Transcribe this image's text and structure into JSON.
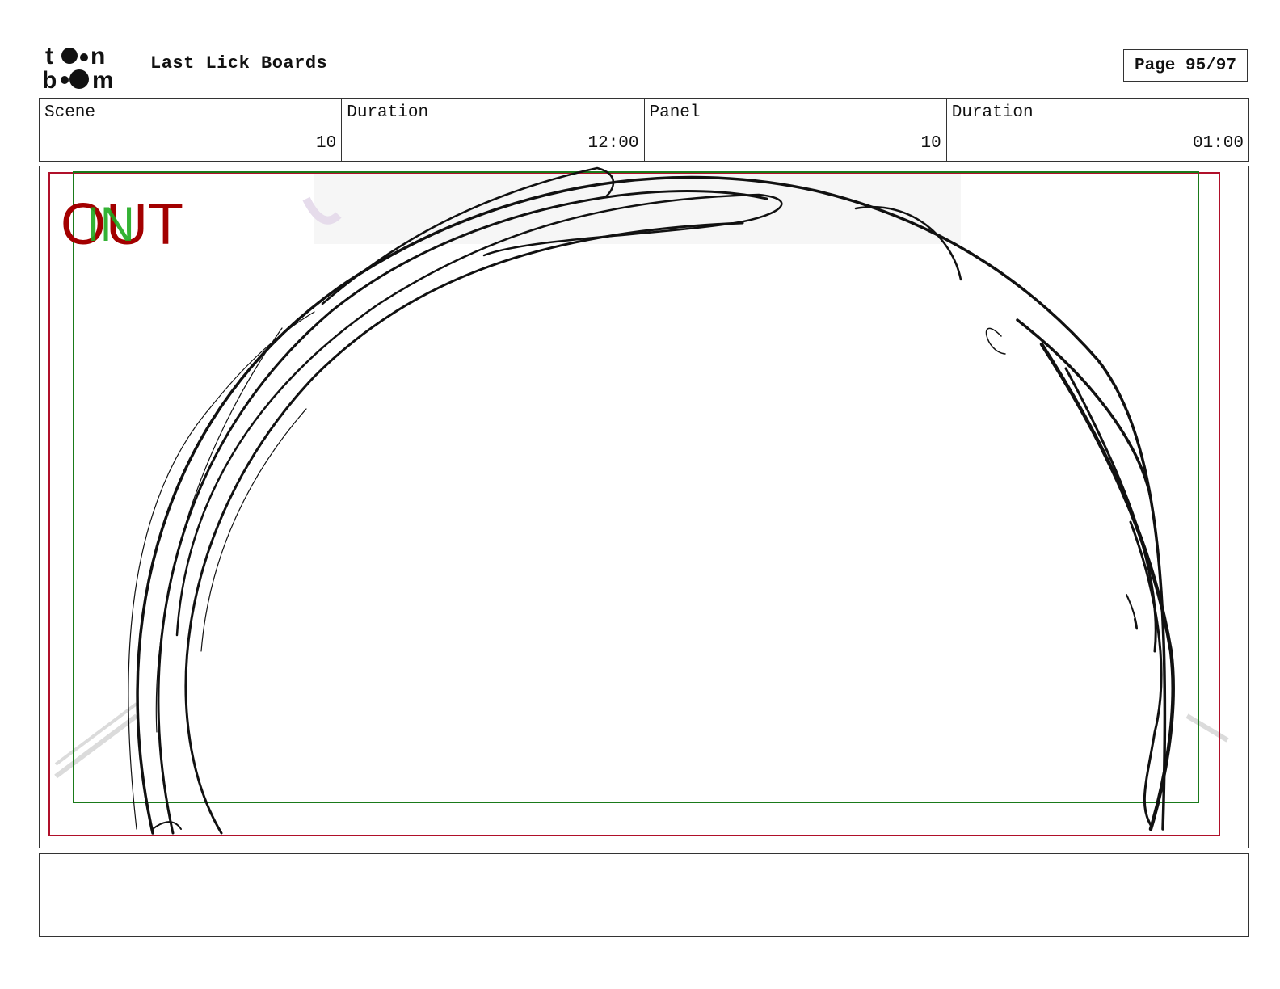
{
  "header": {
    "logo_text": "toon boom",
    "title": "Last Lick Boards",
    "page": "Page 95/97"
  },
  "info": [
    {
      "label": "Scene",
      "value": "10"
    },
    {
      "label": "Duration",
      "value": "12:00"
    },
    {
      "label": "Panel",
      "value": "10"
    },
    {
      "label": "Duration",
      "value": "01:00"
    }
  ],
  "panel": {
    "overlay_out": "OUT",
    "overlay_in": "IN",
    "colors": {
      "out": "#a30000",
      "in": "#1faa1f",
      "safe_frame": "#b0102a",
      "title_safe": "#1a7a1a"
    }
  },
  "notes": {
    "text": ""
  }
}
